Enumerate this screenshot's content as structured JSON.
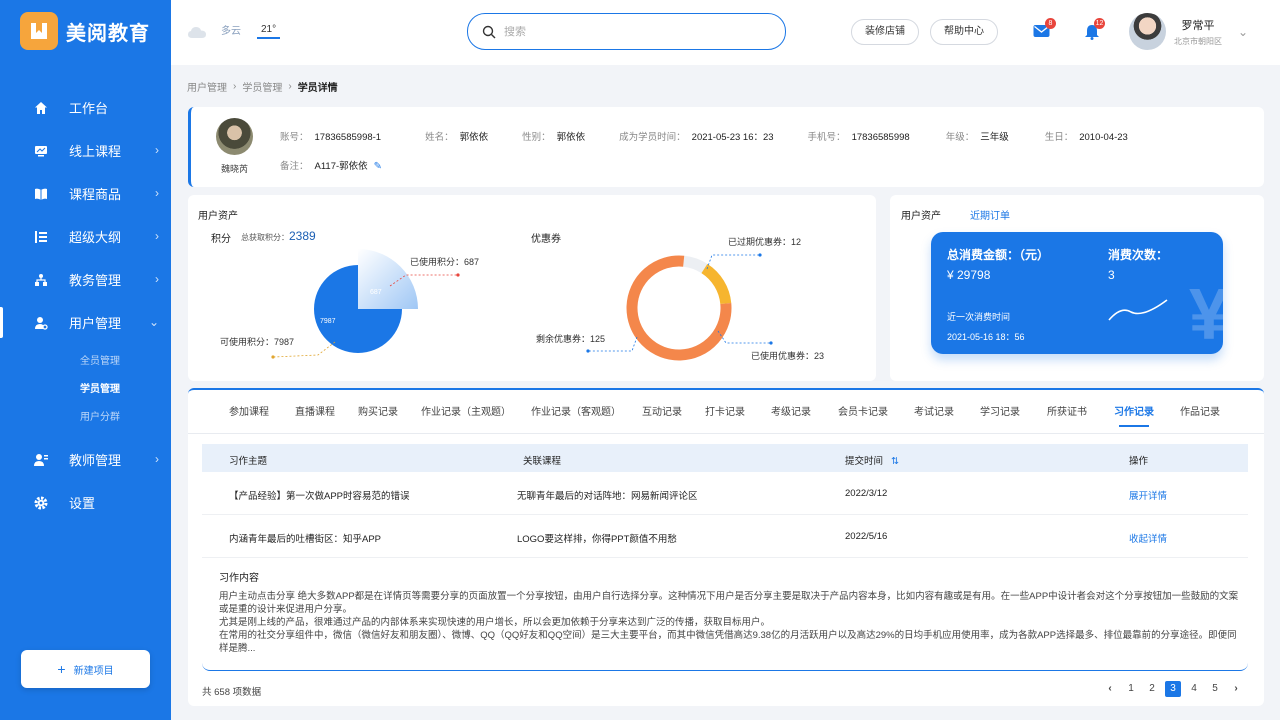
{
  "brand": {
    "name": "美阅教育",
    "color": "#1b77e6",
    "logo_color": "#f6a53c"
  },
  "sidebar": {
    "items": [
      {
        "label": "工作台",
        "icon": "home-icon"
      },
      {
        "label": "线上课程",
        "icon": "monitor-icon"
      },
      {
        "label": "课程商品",
        "icon": "book-icon"
      },
      {
        "label": "超级大纲",
        "icon": "list-icon"
      },
      {
        "label": "教务管理",
        "icon": "org-icon"
      },
      {
        "label": "用户管理",
        "icon": "user-gear-icon"
      },
      {
        "label": "教师管理",
        "icon": "teacher-icon"
      },
      {
        "label": "设置",
        "icon": "gear-icon"
      }
    ],
    "sub_items": [
      "全员管理",
      "学员管理",
      "用户分群"
    ],
    "new_button": "新建项目"
  },
  "topbar": {
    "weather": "多云",
    "temperature": "21°",
    "search_placeholder": "搜索",
    "btn_decorate": "装修店铺",
    "btn_help": "帮助中心",
    "mail_count": "8",
    "bell_count": "12",
    "user_name": "罗常平",
    "user_location": "北京市朝阳区"
  },
  "breadcrumb": [
    "用户管理",
    "学员管理",
    "学员详情"
  ],
  "profile": {
    "name": "魏晓芮",
    "account_label": "账号：",
    "account": "17836585998-1",
    "realname_label": "姓名：",
    "realname": "郭依依",
    "gender_label": "性别：",
    "gender": "郭依依",
    "joined_label": "成为学员时间：",
    "joined": "2021-05-23 16：23",
    "phone_label": "手机号：",
    "phone": "17836585998",
    "grade_label": "年级：",
    "grade": "三年级",
    "birthday_label": "生日：",
    "birthday": "2010-04-23",
    "note_label": "备注：",
    "note": "A117-郭依依"
  },
  "assets": {
    "title": "用户资产",
    "points_title": "积分",
    "points_total_label": "总获取积分：",
    "points_total": "2389",
    "points_used_label": "已使用积分：687",
    "points_avail_label": "可使用积分：7987",
    "points_used_value": "687",
    "points_avail_value": "7987",
    "coupon_title": "优惠券",
    "coupon_expired_label": "已过期优惠券：12",
    "coupon_remaining_label": "剩余优惠券：125",
    "coupon_used_label": "已使用优惠券：23"
  },
  "chart_data": [
    {
      "type": "pie",
      "title": "积分",
      "categories": [
        "可使用积分",
        "已使用积分"
      ],
      "values": [
        7987,
        687
      ],
      "colors": [
        "#1b77e6",
        "#cfe3fb"
      ]
    },
    {
      "type": "pie",
      "title": "优惠券",
      "categories": [
        "剩余优惠券",
        "已使用优惠券",
        "已过期优惠券"
      ],
      "values": [
        125,
        23,
        12
      ],
      "colors": [
        "#f4874b",
        "#f6b52f",
        "#eceff3"
      ]
    }
  ],
  "summary": {
    "title": "用户资产",
    "link": "近期订单",
    "amount_label": "总消费金额：（元）",
    "amount": "¥ 29798",
    "count_label": "消费次数：",
    "count": "3",
    "last_label": "近一次消费时间",
    "last_time": "2021-05-16 18：56"
  },
  "tabs": [
    "参加课程",
    "直播课程",
    "购买记录",
    "作业记录（主观题）",
    "作业记录（客观题）",
    "互动记录",
    "打卡记录",
    "考级记录",
    "会员卡记录",
    "考试记录",
    "学习记录",
    "所获证书",
    "习作记录",
    "作品记录"
  ],
  "table": {
    "headers": [
      "习作主题",
      "关联课程",
      "提交时间",
      "操作"
    ],
    "rows": [
      {
        "topic": "【产品经验】第一次做APP时容易范的错误",
        "course": "无聊青年最后的对话阵地：网易新闻评论区",
        "time": "2022/3/12",
        "action": "展开详情"
      },
      {
        "topic": "内涵青年最后的吐槽街区：知乎APP",
        "course": "LOGO要这样排，你得PPT颜值不用愁",
        "time": "2022/5/16",
        "action": "收起详情"
      }
    ],
    "detail_title": "习作内容",
    "detail_lines": [
      "用户主动点击分享 绝大多数APP都是在详情页等需要分享的页面放置一个分享按钮，由用户自行选择分享。这种情况下用户是否分享主要是取决于产品内容本身，比如内容有趣或是有用。在一些APP中设计者会对这个分享按钮加一些鼓励的文案或是重的设计来促进用户分享。",
      "尤其是刚上线的产品，很难通过产品的内部体系来实现快速的用户增长，所以会更加依赖于分享来达到广泛的传播，获取目标用户。",
      "在常用的社交分享组件中，微信（微信好友和朋友圈）、微博、QQ（QQ好友和QQ空间）是三大主要平台，而其中微信凭借高达9.38亿的月活跃用户以及高达29%的日均手机应用使用率，成为各款APP选择最多、排位最靠前的分享途径。即便同样是腾..."
    ],
    "total": "共 658 项数据",
    "pages": [
      "1",
      "2",
      "3",
      "4",
      "5"
    ],
    "current_page": "3"
  }
}
